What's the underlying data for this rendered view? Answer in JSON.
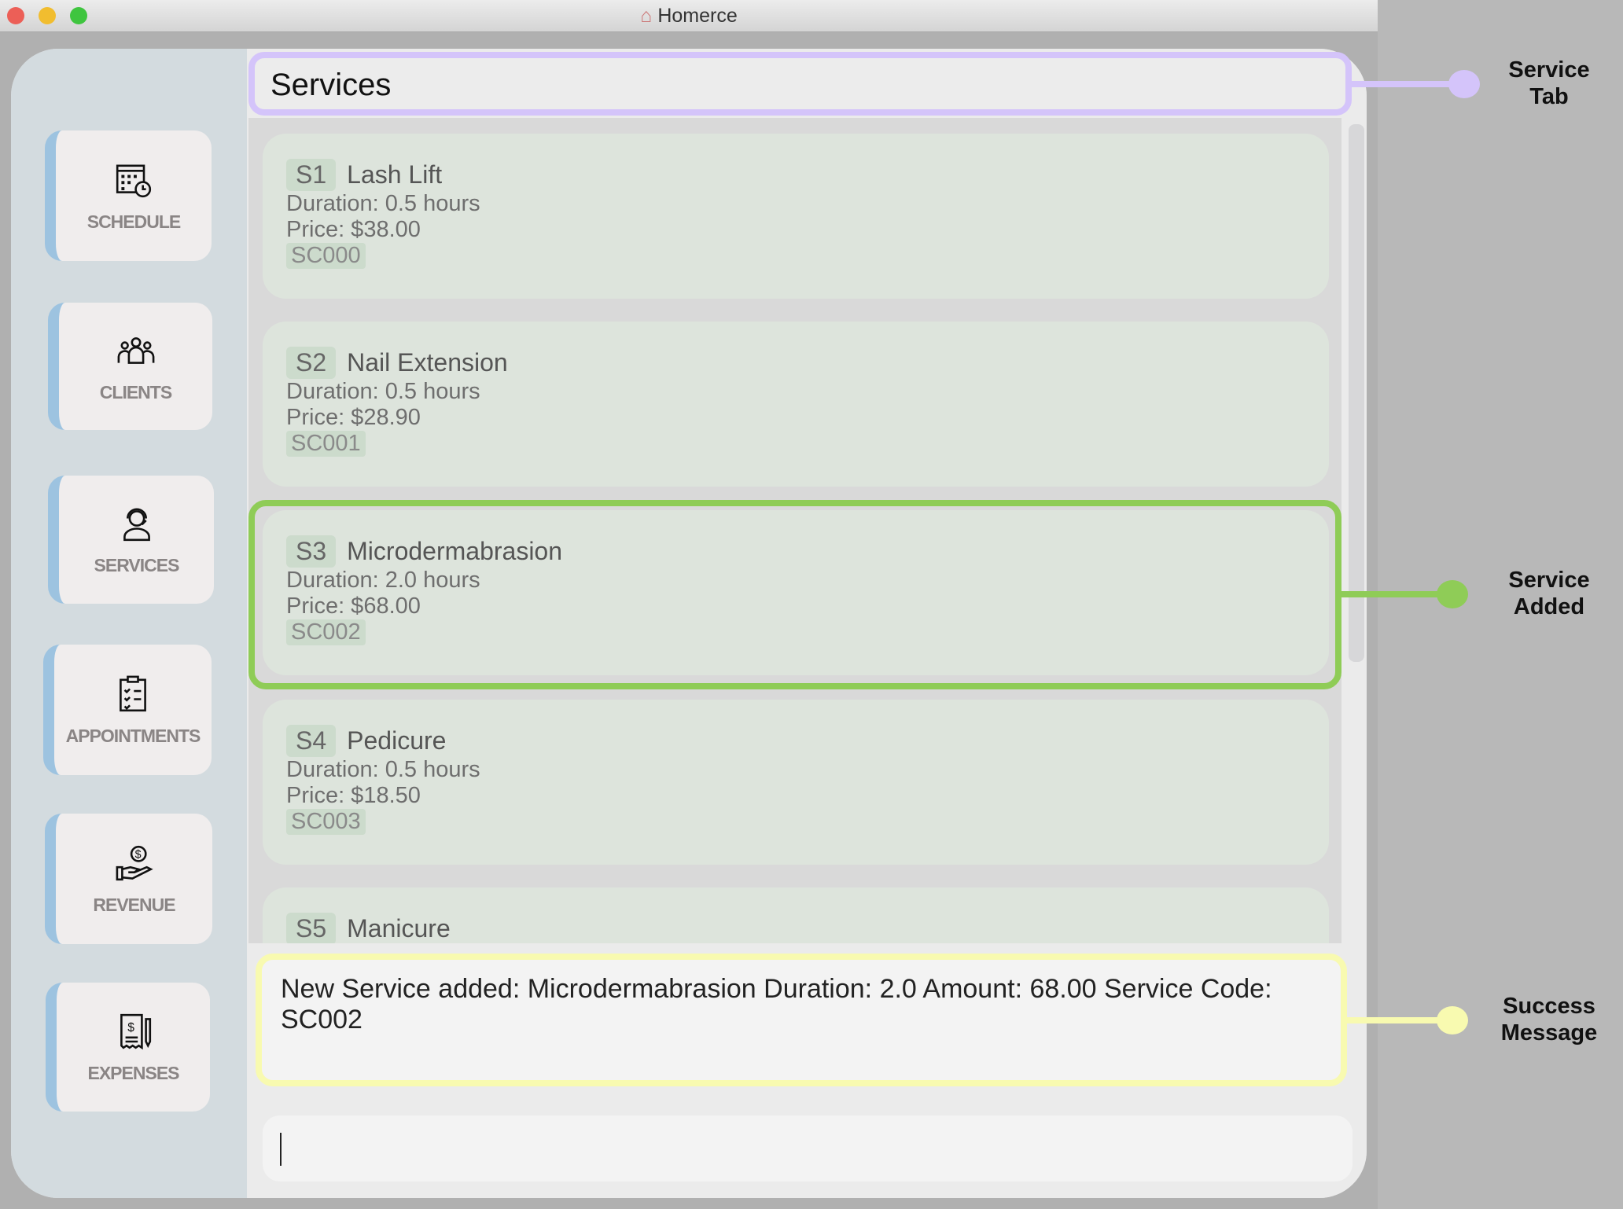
{
  "window": {
    "title": "Homerce"
  },
  "sidebar": {
    "items": [
      {
        "label": "SCHEDULE",
        "icon": "calendar-clock-icon"
      },
      {
        "label": "CLIENTS",
        "icon": "people-icon"
      },
      {
        "label": "SERVICES",
        "icon": "headset-person-icon"
      },
      {
        "label": "APPOINTMENTS",
        "icon": "clipboard-check-icon"
      },
      {
        "label": "REVENUE",
        "icon": "hand-dollar-icon"
      },
      {
        "label": "EXPENSES",
        "icon": "receipt-dollar-icon"
      }
    ]
  },
  "header": {
    "title": "Services"
  },
  "services": [
    {
      "index": "S1",
      "name": "Lash Lift",
      "duration": "Duration: 0.5 hours",
      "price": "Price: $38.00",
      "code": "SC000"
    },
    {
      "index": "S2",
      "name": "Nail Extension",
      "duration": "Duration: 0.5 hours",
      "price": "Price: $28.90",
      "code": "SC001"
    },
    {
      "index": "S3",
      "name": "Microdermabrasion",
      "duration": "Duration: 2.0 hours",
      "price": "Price: $68.00",
      "code": "SC002"
    },
    {
      "index": "S4",
      "name": "Pedicure",
      "duration": "Duration: 0.5 hours",
      "price": "Price: $18.50",
      "code": "SC003"
    },
    {
      "index": "S5",
      "name": "Manicure"
    }
  ],
  "result": {
    "message": "New Service added: Microdermabrasion Duration: 2.0 Amount: 68.00 Service Code: SC002"
  },
  "command": {
    "value": ""
  },
  "annotations": {
    "service_tab": {
      "line1": "Service",
      "line2": "Tab",
      "color": "#d4c4fa"
    },
    "service_added": {
      "line1": "Service",
      "line2": "Added",
      "color": "#8fcc57"
    },
    "success_message": {
      "line1": "Success",
      "line2": "Message",
      "color": "#f8fab0"
    }
  }
}
